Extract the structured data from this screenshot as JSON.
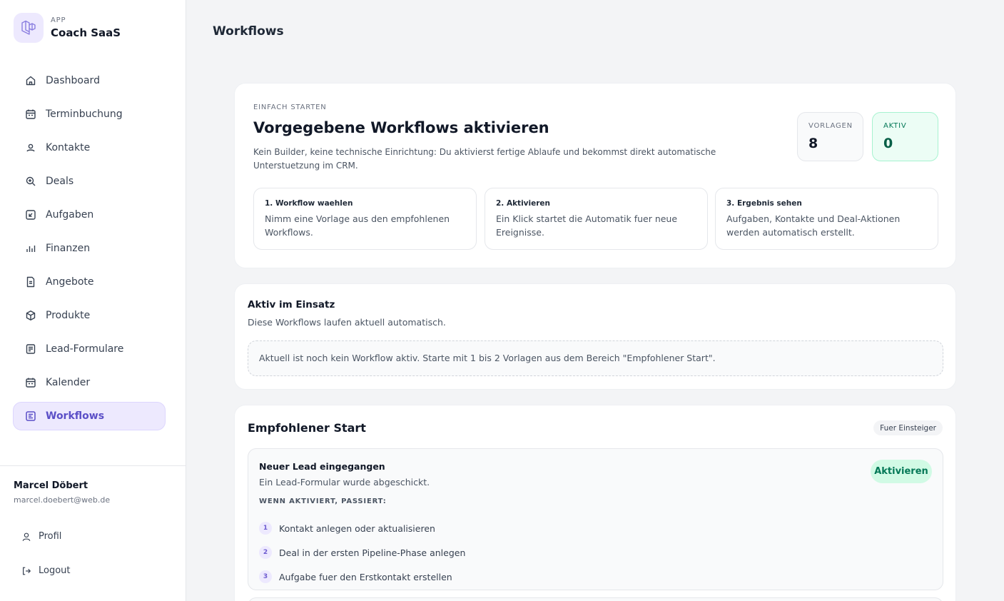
{
  "brand": {
    "kicker": "APP",
    "name": "Coach SaaS"
  },
  "nav": [
    {
      "label": "Dashboard",
      "icon": "home-icon"
    },
    {
      "label": "Terminbuchung",
      "icon": "calendar-icon"
    },
    {
      "label": "Kontakte",
      "icon": "user-icon"
    },
    {
      "label": "Deals",
      "icon": "zoom-icon"
    },
    {
      "label": "Aufgaben",
      "icon": "task-icon"
    },
    {
      "label": "Finanzen",
      "icon": "bar-chart-icon"
    },
    {
      "label": "Angebote",
      "icon": "document-icon"
    },
    {
      "label": "Produkte",
      "icon": "box-icon"
    },
    {
      "label": "Lead-Formulare",
      "icon": "form-icon"
    },
    {
      "label": "Kalender",
      "icon": "calendar-icon"
    },
    {
      "label": "Workflows",
      "icon": "workflow-icon",
      "active": true
    }
  ],
  "user": {
    "name": "Marcel Döbert",
    "email": "marcel.doebert@web.de"
  },
  "account": {
    "profile_label": "Profil",
    "logout_label": "Logout"
  },
  "page": {
    "title": "Workflows"
  },
  "hero": {
    "kicker": "EINFACH STARTEN",
    "title": "Vorgegebene Workflows aktivieren",
    "description": "Kein Builder, keine technische Einrichtung: Du aktivierst fertige Ablaufe und bekommst direkt automatische Unterstuetzung im CRM.",
    "stats": [
      {
        "label": "VORLAGEN",
        "value": "8"
      },
      {
        "label": "AKTIV",
        "value": "0"
      }
    ],
    "steps": [
      {
        "title": "1. Workflow waehlen",
        "desc": "Nimm eine Vorlage aus den empfohlenen Workflows."
      },
      {
        "title": "2. Aktivieren",
        "desc": "Ein Klick startet die Automatik fuer neue Ereignisse."
      },
      {
        "title": "3. Ergebnis sehen",
        "desc": "Aufgaben, Kontakte und Deal-Aktionen werden automatisch erstellt."
      }
    ]
  },
  "active_section": {
    "title": "Aktiv im Einsatz",
    "subtitle": "Diese Workflows laufen aktuell automatisch.",
    "empty_notice": "Aktuell ist noch kein Workflow aktiv. Starte mit 1 bis 2 Vorlagen aus dem Bereich \"Empfohlener Start\"."
  },
  "recommended": {
    "title": "Empfohlener Start",
    "badge": "Fuer Einsteiger",
    "workflow": {
      "title": "Neuer Lead eingegangen",
      "desc": "Ein Lead-Formular wurde abgeschickt.",
      "caption": "WENN AKTIVIERT, PASSIERT:",
      "button": "Aktivieren",
      "steps": [
        {
          "num": "1",
          "text": "Kontakt anlegen oder aktualisieren"
        },
        {
          "num": "2",
          "text": "Deal in der ersten Pipeline-Phase anlegen"
        },
        {
          "num": "3",
          "text": "Aufgabe fuer den Erstkontakt erstellen"
        }
      ]
    }
  },
  "colors": {
    "accent": "#5b4fc7",
    "accent_bg": "#ede9fe",
    "success": "#047857",
    "success_bg": "#d1fae5"
  }
}
